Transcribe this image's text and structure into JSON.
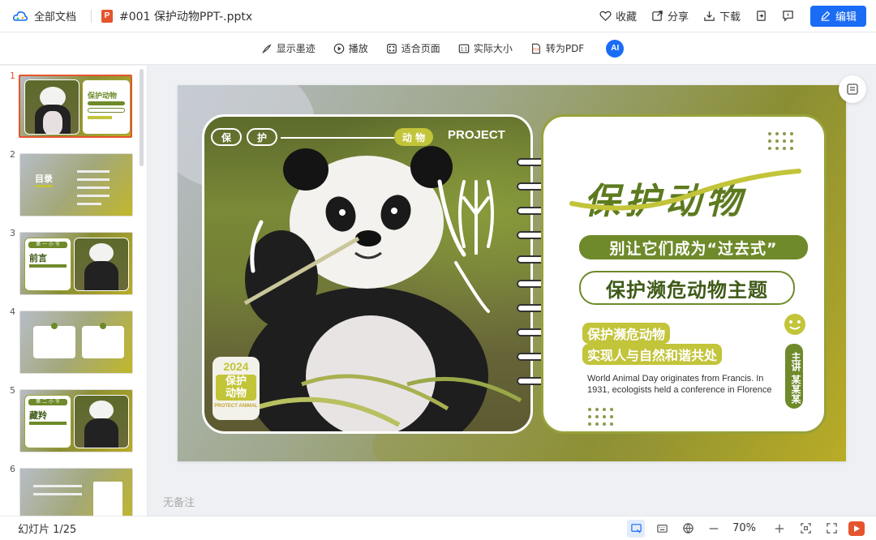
{
  "topbar": {
    "breadcrumb": "全部文档",
    "file_name": "#001 保护动物PPT-.pptx",
    "file_badge": "P",
    "favorite": "收藏",
    "share": "分享",
    "download": "下载",
    "edit": "编辑"
  },
  "toolbar": {
    "show_ink": "显示墨迹",
    "play": "播放",
    "fit_page": "适合页面",
    "actual_size": "实际大小",
    "to_pdf": "转为PDF",
    "ai": "AI"
  },
  "sidebar": {
    "slides": [
      {
        "num": "1",
        "active": true
      },
      {
        "num": "2",
        "title": "目录"
      },
      {
        "num": "3",
        "title": "前言",
        "section": "第 一 小 节"
      },
      {
        "num": "4"
      },
      {
        "num": "5",
        "title": "藏羚",
        "section": "第 二 小 节"
      },
      {
        "num": "6"
      }
    ]
  },
  "slide": {
    "tag1": "保",
    "tag2": "护",
    "tag3": "动 物",
    "project": "PROJECT",
    "year": "2024",
    "year_title": "保护\n动物",
    "protect_animal": "PROTECT ANIMAL",
    "main_title": "保护动物",
    "subtitle_pill": "别让它们成为“过去式”",
    "theme_pill": "保护濒危动物主题",
    "hl1": "保护濒危动物",
    "hl2": "实现人与自然和谐共处",
    "body": "World Animal Day originates from Francis. In 1931, ecologists held a conference in Florence",
    "speaker": "主讲 某某某"
  },
  "notes": "无备注",
  "status": {
    "page_info": "幻灯片 1/25",
    "zoom": "70%"
  },
  "colors": {
    "accent": "#1a6cf5",
    "green": "#6e8a2a",
    "lime": "#c2c43a",
    "ppt_orange": "#e5552d"
  }
}
